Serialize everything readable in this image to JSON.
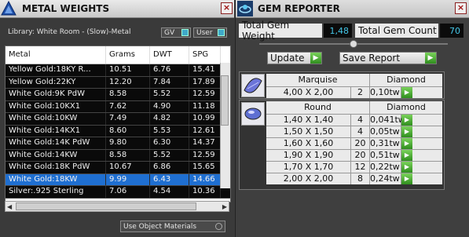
{
  "metal_panel": {
    "title": "METAL WEIGHTS",
    "close": "×",
    "library_label": "Library: White Room - (Slow)-Metal",
    "toggle_gv": "GV",
    "toggle_user": "User",
    "columns": [
      "Metal",
      "Grams",
      "DWT",
      "SPG"
    ],
    "rows": [
      {
        "metal": "Yellow Gold:18KY R...",
        "grams": "10.51",
        "dwt": "6.76",
        "spg": "15.41"
      },
      {
        "metal": "Yellow Gold:22KY",
        "grams": "12.20",
        "dwt": "7.84",
        "spg": "17.89"
      },
      {
        "metal": "White Gold:9K PdW",
        "grams": "8.58",
        "dwt": "5.52",
        "spg": "12.59"
      },
      {
        "metal": "White Gold:10KX1",
        "grams": "7.62",
        "dwt": "4.90",
        "spg": "11.18"
      },
      {
        "metal": "White Gold:10KW",
        "grams": "7.49",
        "dwt": "4.82",
        "spg": "10.99"
      },
      {
        "metal": "White Gold:14KX1",
        "grams": "8.60",
        "dwt": "5.53",
        "spg": "12.61"
      },
      {
        "metal": "White Gold:14K PdW",
        "grams": "9.80",
        "dwt": "6.30",
        "spg": "14.37"
      },
      {
        "metal": "White Gold:14KW",
        "grams": "8.58",
        "dwt": "5.52",
        "spg": "12.59"
      },
      {
        "metal": "White Gold:18K PdW",
        "grams": "10.67",
        "dwt": "6.86",
        "spg": "15.65"
      },
      {
        "metal": "White Gold:18KW",
        "grams": "9.99",
        "dwt": "6.43",
        "spg": "14.66"
      },
      {
        "metal": "Silver:.925 Sterling",
        "grams": "7.06",
        "dwt": "4.54",
        "spg": "10.36"
      }
    ],
    "selected_row": 9,
    "use_object_materials": "Use Object Materials"
  },
  "gem_panel": {
    "title": "GEM REPORTER",
    "close": "×",
    "total_weight_label": "Total Gem Weight",
    "total_weight_value": "1,48",
    "total_count_label": "Total Gem Count",
    "total_count_value": "70",
    "update_label": "Update",
    "save_label": "Save Report",
    "groups": [
      {
        "shape": "Marquise",
        "stone": "Diamond",
        "rows": [
          {
            "size": "4,00 X 2,00",
            "qty": "2",
            "weight": "0,10tw"
          }
        ]
      },
      {
        "shape": "Round",
        "stone": "Diamond",
        "rows": [
          {
            "size": "1,40 X 1,40",
            "qty": "4",
            "weight": "0,041tw"
          },
          {
            "size": "1,50 X 1,50",
            "qty": "4",
            "weight": "0,05tw"
          },
          {
            "size": "1,60 X 1,60",
            "qty": "20",
            "weight": "0,31tw"
          },
          {
            "size": "1,90 X 1,90",
            "qty": "20",
            "weight": "0,51tw"
          },
          {
            "size": "1,70 X 1,70",
            "qty": "12",
            "weight": "0,22tw"
          },
          {
            "size": "2,00 X 2,00",
            "qty": "8",
            "weight": "0,24tw"
          }
        ]
      }
    ]
  },
  "colors": {
    "selection": "#1f6fd1",
    "value_text": "#45c7e8",
    "go_button": "#3a9a28"
  },
  "icons": [
    "metal-weights-logo-icon",
    "gem-reporter-logo-icon",
    "close-icon",
    "play-arrow-icon",
    "marquise-gem-icon",
    "round-gem-icon"
  ]
}
